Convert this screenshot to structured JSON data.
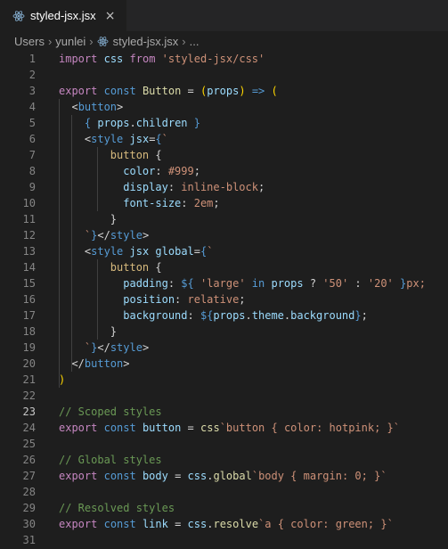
{
  "tab": {
    "title": "styled-jsx.jsx",
    "close": "×"
  },
  "breadcrumb": {
    "items": [
      "Users",
      "yunlei",
      "styled-jsx.jsx",
      "..."
    ],
    "sep": "›"
  },
  "editor": {
    "current_line": 23,
    "lines": [
      {
        "n": "1",
        "seg": [
          [
            "import",
            "k"
          ],
          [
            " ",
            "p"
          ],
          [
            "css",
            "v"
          ],
          [
            " ",
            "p"
          ],
          [
            "from",
            "k"
          ],
          [
            " ",
            "p"
          ],
          [
            "'styled-jsx/css'",
            "s"
          ]
        ]
      },
      {
        "n": "2",
        "seg": []
      },
      {
        "n": "3",
        "seg": [
          [
            "export",
            "k"
          ],
          [
            " ",
            "p"
          ],
          [
            "const",
            "kb"
          ],
          [
            " ",
            "p"
          ],
          [
            "Button",
            "f"
          ],
          [
            " = ",
            "p"
          ],
          [
            "(",
            "y"
          ],
          [
            "props",
            "v"
          ],
          [
            ")",
            "y"
          ],
          [
            " ",
            "p"
          ],
          [
            "=>",
            "kb"
          ],
          [
            " ",
            "p"
          ],
          [
            "(",
            "y"
          ]
        ]
      },
      {
        "n": "4",
        "seg": [
          [
            "  ",
            "p"
          ],
          [
            "<",
            "p"
          ],
          [
            "button",
            "t"
          ],
          [
            ">",
            "p"
          ]
        ]
      },
      {
        "n": "5",
        "seg": [
          [
            "    ",
            "p"
          ],
          [
            "{",
            "kb"
          ],
          [
            " ",
            "p"
          ],
          [
            "props",
            "v"
          ],
          [
            ".",
            "p"
          ],
          [
            "children",
            "v"
          ],
          [
            " ",
            "p"
          ],
          [
            "}",
            "kb"
          ]
        ]
      },
      {
        "n": "6",
        "seg": [
          [
            "    ",
            "p"
          ],
          [
            "<",
            "p"
          ],
          [
            "style",
            "t"
          ],
          [
            " ",
            "p"
          ],
          [
            "jsx",
            "v"
          ],
          [
            "=",
            "p"
          ],
          [
            "{",
            "kb"
          ],
          [
            "`",
            "s"
          ]
        ]
      },
      {
        "n": "7",
        "seg": [
          [
            "        ",
            "p"
          ],
          [
            "button",
            "sel"
          ],
          [
            " {",
            "p"
          ]
        ]
      },
      {
        "n": "8",
        "seg": [
          [
            "          ",
            "p"
          ],
          [
            "color",
            "pr"
          ],
          [
            ": ",
            "p"
          ],
          [
            "#999",
            "s"
          ],
          [
            ";",
            "p"
          ]
        ]
      },
      {
        "n": "9",
        "seg": [
          [
            "          ",
            "p"
          ],
          [
            "display",
            "pr"
          ],
          [
            ": ",
            "p"
          ],
          [
            "inline-block",
            "s"
          ],
          [
            ";",
            "p"
          ]
        ]
      },
      {
        "n": "10",
        "seg": [
          [
            "          ",
            "p"
          ],
          [
            "font-size",
            "pr"
          ],
          [
            ": ",
            "p"
          ],
          [
            "2em",
            "s"
          ],
          [
            ";",
            "p"
          ]
        ]
      },
      {
        "n": "11",
        "seg": [
          [
            "        ",
            "p"
          ],
          [
            "}",
            "p"
          ]
        ]
      },
      {
        "n": "12",
        "seg": [
          [
            "    ",
            "p"
          ],
          [
            "`",
            "s"
          ],
          [
            "}",
            "kb"
          ],
          [
            "</",
            "p"
          ],
          [
            "style",
            "t"
          ],
          [
            ">",
            "p"
          ]
        ]
      },
      {
        "n": "13",
        "seg": [
          [
            "    ",
            "p"
          ],
          [
            "<",
            "p"
          ],
          [
            "style",
            "t"
          ],
          [
            " ",
            "p"
          ],
          [
            "jsx",
            "v"
          ],
          [
            " ",
            "p"
          ],
          [
            "global",
            "v"
          ],
          [
            "=",
            "p"
          ],
          [
            "{",
            "kb"
          ],
          [
            "`",
            "s"
          ]
        ]
      },
      {
        "n": "14",
        "seg": [
          [
            "        ",
            "p"
          ],
          [
            "button",
            "sel"
          ],
          [
            " {",
            "p"
          ]
        ]
      },
      {
        "n": "15",
        "seg": [
          [
            "          ",
            "p"
          ],
          [
            "padding",
            "pr"
          ],
          [
            ": ",
            "p"
          ],
          [
            "${",
            "kb"
          ],
          [
            " ",
            "p"
          ],
          [
            "'large'",
            "s"
          ],
          [
            " ",
            "p"
          ],
          [
            "in",
            "kb"
          ],
          [
            " ",
            "p"
          ],
          [
            "props",
            "v"
          ],
          [
            " ? ",
            "p"
          ],
          [
            "'50'",
            "s"
          ],
          [
            " : ",
            "p"
          ],
          [
            "'20'",
            "s"
          ],
          [
            " ",
            "p"
          ],
          [
            "}",
            "kb"
          ],
          [
            "px;",
            "s"
          ]
        ]
      },
      {
        "n": "16",
        "seg": [
          [
            "          ",
            "p"
          ],
          [
            "position",
            "pr"
          ],
          [
            ": ",
            "p"
          ],
          [
            "relative",
            "s"
          ],
          [
            ";",
            "p"
          ]
        ]
      },
      {
        "n": "17",
        "seg": [
          [
            "          ",
            "p"
          ],
          [
            "background",
            "pr"
          ],
          [
            ": ",
            "p"
          ],
          [
            "${",
            "kb"
          ],
          [
            "props",
            "v"
          ],
          [
            ".",
            "p"
          ],
          [
            "theme",
            "v"
          ],
          [
            ".",
            "p"
          ],
          [
            "background",
            "v"
          ],
          [
            "}",
            "kb"
          ],
          [
            ";",
            "p"
          ]
        ]
      },
      {
        "n": "18",
        "seg": [
          [
            "        ",
            "p"
          ],
          [
            "}",
            "p"
          ]
        ]
      },
      {
        "n": "19",
        "seg": [
          [
            "    ",
            "p"
          ],
          [
            "`",
            "s"
          ],
          [
            "}",
            "kb"
          ],
          [
            "</",
            "p"
          ],
          [
            "style",
            "t"
          ],
          [
            ">",
            "p"
          ]
        ]
      },
      {
        "n": "20",
        "seg": [
          [
            "  ",
            "p"
          ],
          [
            "</",
            "p"
          ],
          [
            "button",
            "t"
          ],
          [
            ">",
            "p"
          ]
        ]
      },
      {
        "n": "21",
        "seg": [
          [
            ")",
            "y"
          ]
        ]
      },
      {
        "n": "22",
        "seg": []
      },
      {
        "n": "23",
        "seg": [
          [
            "// Scoped styles",
            "c"
          ]
        ]
      },
      {
        "n": "24",
        "seg": [
          [
            "export",
            "k"
          ],
          [
            " ",
            "p"
          ],
          [
            "const",
            "kb"
          ],
          [
            " ",
            "p"
          ],
          [
            "button",
            "v"
          ],
          [
            " = ",
            "p"
          ],
          [
            "css",
            "f"
          ],
          [
            "`",
            "s"
          ],
          [
            "button { color: hotpink; }",
            "s"
          ],
          [
            "`",
            "s"
          ]
        ]
      },
      {
        "n": "25",
        "seg": []
      },
      {
        "n": "26",
        "seg": [
          [
            "// Global styles",
            "c"
          ]
        ]
      },
      {
        "n": "27",
        "seg": [
          [
            "export",
            "k"
          ],
          [
            " ",
            "p"
          ],
          [
            "const",
            "kb"
          ],
          [
            " ",
            "p"
          ],
          [
            "body",
            "v"
          ],
          [
            " = ",
            "p"
          ],
          [
            "css",
            "v"
          ],
          [
            ".",
            "p"
          ],
          [
            "global",
            "f"
          ],
          [
            "`",
            "s"
          ],
          [
            "body { margin: 0; }",
            "s"
          ],
          [
            "`",
            "s"
          ]
        ]
      },
      {
        "n": "28",
        "seg": []
      },
      {
        "n": "29",
        "seg": [
          [
            "// Resolved styles",
            "c"
          ]
        ]
      },
      {
        "n": "30",
        "seg": [
          [
            "export",
            "k"
          ],
          [
            " ",
            "p"
          ],
          [
            "const",
            "kb"
          ],
          [
            " ",
            "p"
          ],
          [
            "link",
            "v"
          ],
          [
            " = ",
            "p"
          ],
          [
            "css",
            "v"
          ],
          [
            ".",
            "p"
          ],
          [
            "resolve",
            "f"
          ],
          [
            "`",
            "s"
          ],
          [
            "a { color: green; }",
            "s"
          ],
          [
            "`",
            "s"
          ]
        ]
      },
      {
        "n": "31",
        "seg": []
      }
    ]
  }
}
